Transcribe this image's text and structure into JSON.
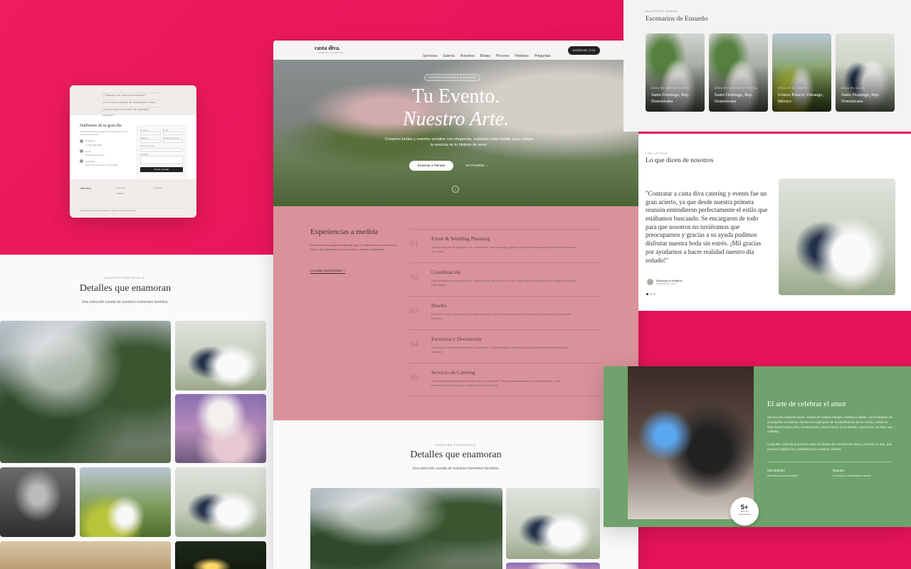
{
  "contact_card": {
    "faq": [
      "¿Trabajan con otros proveedores?",
      "¿Con cuánto tiempo de anticipación debo reservar?",
      "¿Qué incluye el servicio de catering?"
    ],
    "title": "Hablemos de tu gran día",
    "intro": "Cuéntanos sobre tu evento y te responderemos en menos de 24 horas.",
    "contact_lines": [
      "WhatsApp",
      "+1 809 000 0000",
      "Email",
      "info@castadiva.com",
      "Ubicación",
      "Santo Domingo, Rep. Dominicana"
    ],
    "form_labels": [
      "Nombre",
      "Email",
      "Teléfono",
      "Fecha del evento",
      "Tipo de evento",
      "Mensaje"
    ],
    "send_label": "Enviar mensaje",
    "footer_brand": "casta diva.",
    "footer_cols": [
      "Servicios",
      "Galería",
      "Contacto"
    ],
    "copyright": "© 2024 Casta Diva Catering & Eventos. Todos los derechos reservados."
  },
  "left_portfolio": {
    "kicker": "NUESTRO PORTAFOLIO",
    "title": "Detalles que enamoran",
    "subtitle": "Una selección curada de nuestros momentos favoritos."
  },
  "main_site": {
    "brand": "casta diva.",
    "brand_sub": "CATERING & EVENTOS",
    "nav": [
      "Servicios",
      "Galería",
      "Nosotros",
      "Bodas",
      "Proceso",
      "Historias",
      "Preguntas"
    ],
    "cta_nav": "AGENDAR CITA",
    "hero": {
      "kicker": "WEDDING PLANNER & EVENTS",
      "line1": "Tu Evento.",
      "line2": "Nuestro Arte.",
      "desc": "Creamos bodas y eventos sociales con elegancia, cuidando cada detalle para reflejar la esencia de tu historia de amor.",
      "primary": "Empezar a Planear",
      "secondary": "Ver Portafolio"
    },
    "experiences": {
      "title": "Experiencias a medida",
      "intro": "No creamos un paquete estándar para ti. Cada boda es un lienzo en blanco que pintamos con tus sueños y nuestra experiencia.",
      "link": "Consultar disponibilidad",
      "items": [
        {
          "num": "01",
          "title": "Event & Wedding Planning",
          "desc": "Gestión integral de principio a fin. Diseñamos presupuestos, logística y proveedores para que disfrutes del proceso sin estrés."
        },
        {
          "num": "02",
          "title": "Coordinación",
          "desc": "Para quienes ya planearon todo. Tomamos las riendas en el \"Día D\" para que el cronograma y el equipo funcionen impecables."
        },
        {
          "num": "03",
          "title": "Diseño",
          "desc": "Dirección visual, papelería y concepto creativo. Creamos la estética de la boda para una narrativa de espacios perfecta."
        },
        {
          "num": "04",
          "title": "Escultura y Decoración",
          "desc": "Creación de escenarios, florales e iluminación. Transformamos espacios vacíos en ambientes emocionales y mágicos."
        },
        {
          "num": "05",
          "title": "Servicio de Catering",
          "desc": "Una experiencia culinaria a la altura de tu celebración. Menús personalizados, montaje elegante y una presentación exquisita que deleita todos los sentidos."
        }
      ]
    },
    "portfolio": {
      "kicker": "NUESTRO PORTAFOLIO",
      "title": "Detalles que enamoran",
      "subtitle": "Una selección curada de nuestros momentos favoritos."
    }
  },
  "venues_card": {
    "kicker": "NUESTRAS BODAS",
    "title": "Escenarios de Ensueño",
    "items": [
      {
        "kicker": "BODA EN JARDÍN PRIVADO",
        "place": "Santo Domingo, Rep. Dominicana"
      },
      {
        "kicker": "BODA EN JARDÍN DE CRISTAL",
        "place": "Santo Domingo, Rep. Dominicana"
      },
      {
        "kicker": "BODA EN EL CAMPO",
        "place": "Gómez Palacio, Durango, México"
      },
      {
        "kicker": "BODA EN SALÓN",
        "place": "Santo Domingo, Rep. Dominicana"
      }
    ]
  },
  "testimonial_card": {
    "kicker": "LOS LETRAS",
    "title": "Lo que dicen de nosotros",
    "quote": "\"Contratar a casta diva catering y events fue un gran acierto, ya que desde nuestra primera reunión entendieron perfectamente el estilo que estábamos buscando. Se encargaron de todo para que nosotros no tuviéramos que preocuparnos y gracias a su ayuda pudimos disfrutar nuestra boda sin estrés. ¡Mil gracias por ayudarnos a hacer realidad nuestro día soñado!\"",
    "author": "Elsalvyss & Milagros",
    "date": "Septiembre, 2024"
  },
  "about_card": {
    "title": "El arte de celebrar el amor",
    "p1": "Somos una empresa joven, creada de manera integra, creativa y afable, con el objetivo de acompañar a nuestros clientes en cada paso de la planificación de su evento, desde la idea hasta la ejecución, visualizando y dando forma a los detalles, para hacer de ellos una realidad.",
    "p2": "Consultar Catering & Eventos nace del deseo de convertir las ideas y sueños en arte, que generen inspiración y satisfacción a nuestros clientes.",
    "stat_value": "5+",
    "stat_label": "Años de Experiencia",
    "col1_title": "Sensibilidad",
    "col1_text": "Atención personal al detalle",
    "col2_title": "Rapidez",
    "col2_text": "Soluciones y creatividad en acción"
  },
  "colors": {
    "magenta": "#e8145a",
    "dusty_rose": "#d9929a",
    "sage": "#6fa26c",
    "ink": "#222222"
  }
}
